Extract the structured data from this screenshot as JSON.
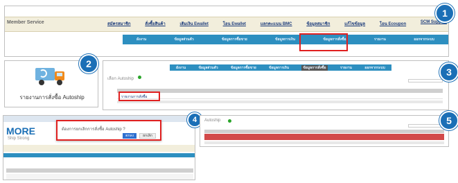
{
  "panel1": {
    "app_title": "Member Service",
    "nav": [
      "สมัครสมาชิก",
      "สั่งซื้อสินค้า",
      "เติมเงิน Ewallet",
      "โอน Ewallet",
      "แลกคะแนน BMC",
      "ข้อมูลสมาชิก",
      "แก้ไขข้อมูล",
      "โอน Ecoupon",
      "SCM Support"
    ],
    "subnav": [
      "ผังงาน",
      "ข้อมูลส่วนตัว",
      "ข้อมูลการซื้อขาย",
      "ข้อมูลการเงิน",
      "ข้อมูลการสั่งซื้อ",
      "รายงาน",
      "ออกจากระบบ"
    ]
  },
  "panel2": {
    "label": "รายงานการสั่งซื้อ Autoship"
  },
  "panel3": {
    "tabs": [
      "ผังงาน",
      "ข้อมูลส่วนตัว",
      "ข้อมูลการซื้อขาย",
      "ข้อมูลการเงิน",
      "ข้อมูลการสั่งซื้อ",
      "รายงาน",
      "ออกจากระบบ"
    ],
    "filter_label": "เลือก Autoship",
    "row_label": "รายงานการสั่งซื้อ"
  },
  "panel4": {
    "brand": "MORE",
    "sub": "Ship Strong",
    "dialog_text": "ต้องการยกเลิกการสั่งซื้อ Autoship ?",
    "ok": "ตกลง",
    "cancel": "ยกเลิก"
  },
  "panel5": {
    "status": "Autoship"
  },
  "badges": [
    "1",
    "2",
    "3",
    "4",
    "5"
  ],
  "colors": {
    "accent": "#1b6fb6",
    "tab": "#2d8fc0",
    "nav_bg": "#f2eedc",
    "highlight": "#e02020",
    "row_red": "#d24a4a"
  }
}
